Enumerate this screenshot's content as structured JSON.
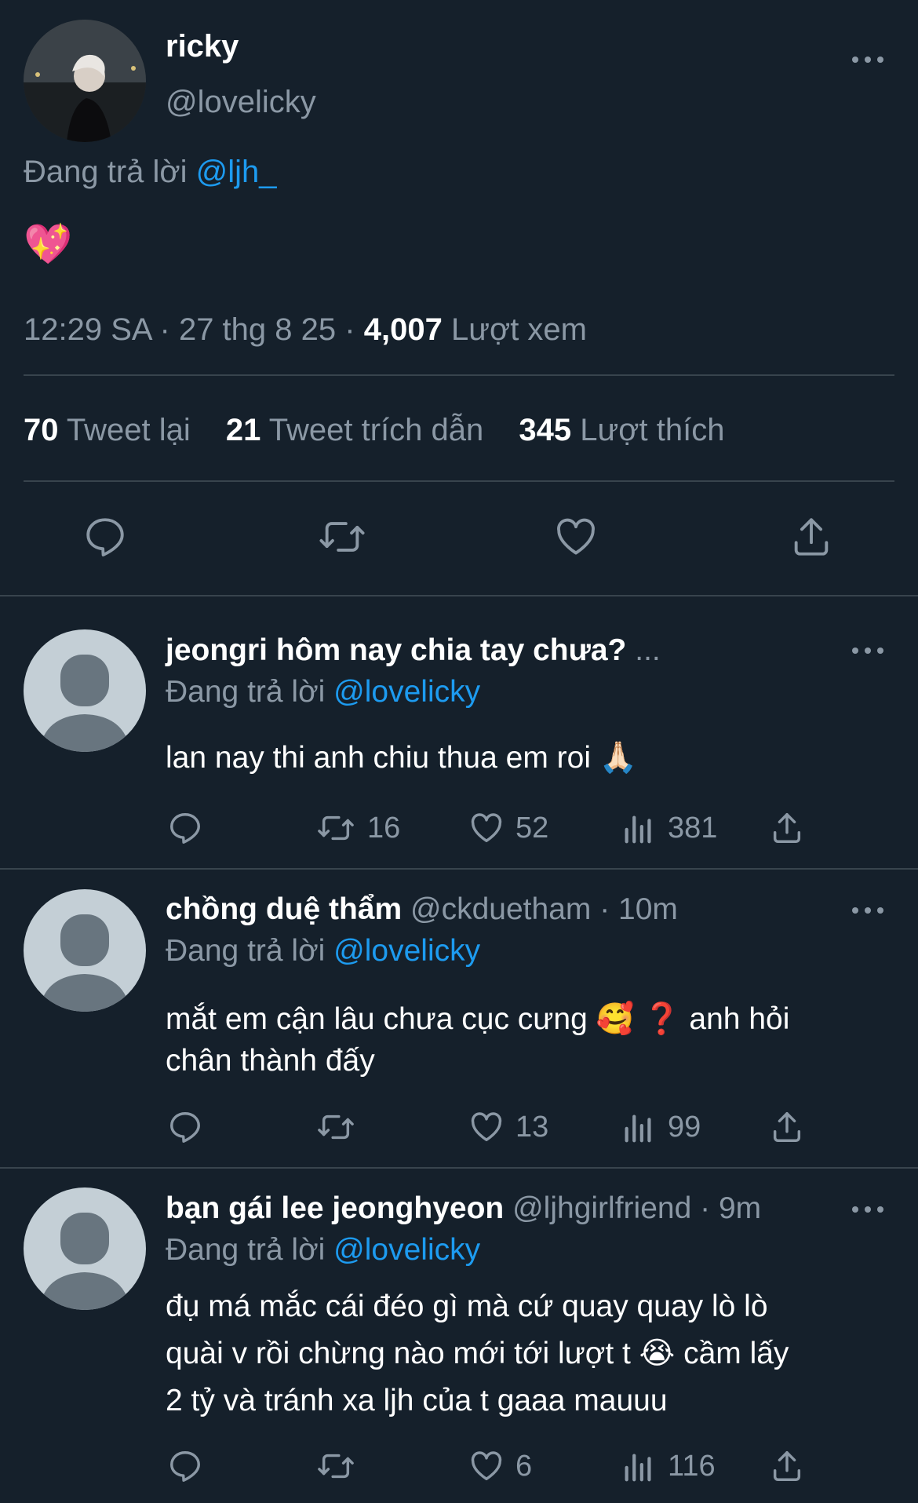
{
  "main_tweet": {
    "display_name": "ricky",
    "handle": "@lovelicky",
    "replying_prefix": "Đang trả lời",
    "replying_to": "@ljh_",
    "emoji": "💖",
    "time": "12:29 SA",
    "sep1": "·",
    "date": "27 thg 8 25",
    "sep2": "·",
    "views_count": "4,007",
    "views_label": "Lượt xem",
    "stats": {
      "retweets_count": "70",
      "retweets_label": "Tweet lại",
      "quotes_count": "21",
      "quotes_label": "Tweet trích dẫn",
      "likes_count": "345",
      "likes_label": "Lượt thích"
    }
  },
  "replies": [
    {
      "display_name": "jeongri hôm nay chia tay chưa?",
      "ellipsis": "...",
      "handle": "",
      "time": "",
      "replying_prefix": "Đang trả lời",
      "replying_to": "@lovelicky",
      "text_lines": [
        "lan nay thi anh chiu thua em roi 🙏🏻"
      ],
      "retweets": "16",
      "likes": "52",
      "views": "381"
    },
    {
      "display_name": "chồng duệ thẩm",
      "ellipsis": "",
      "handle": "@ckduetham",
      "time": "· 10m",
      "replying_prefix": "Đang trả lời",
      "replying_to": "@lovelicky",
      "text_lines": [
        "mắt em cận lâu chưa cục cưng 🥰 ❓ anh hỏi",
        "chân thành đấy"
      ],
      "retweets": "",
      "likes": "13",
      "views": "99"
    },
    {
      "display_name": "bạn gái lee jeonghyeon",
      "ellipsis": "",
      "handle": "@ljhgirlfriend",
      "time": "· 9m",
      "replying_prefix": "Đang trả lời",
      "replying_to": "@lovelicky",
      "text_lines": [
        "đụ má mắc cái đéo gì mà cứ quay quay lò lò",
        "quài v rồi chừng nào mới tới lượt t 😭  cầm lấy",
        "2 tỷ và tránh xa ljh của t gaaa mauuu"
      ],
      "retweets": "",
      "likes": "6",
      "views": "116"
    }
  ],
  "icons": [
    "reply-icon",
    "retweet-icon",
    "like-icon",
    "share-icon",
    "views-icon",
    "more-icon"
  ],
  "colors": {
    "background": "#15202b",
    "text": "#ffffff",
    "muted": "#8b98a5",
    "link": "#1d9bf0",
    "divider": "#38444d"
  }
}
